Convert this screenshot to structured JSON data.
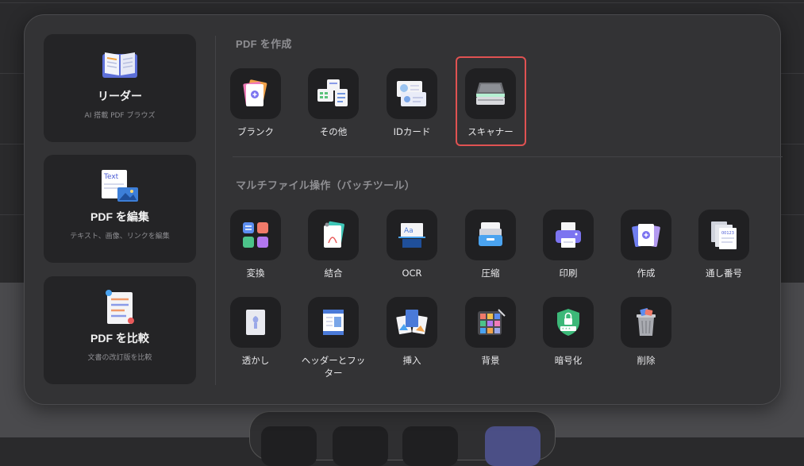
{
  "side_cards": [
    {
      "title": "リーダー",
      "subtitle": "AI 搭載 PDF ブラウズ",
      "icon": "book-icon"
    },
    {
      "title": "PDF を編集",
      "subtitle": "テキスト、画像、リンクを編集",
      "icon": "edit-text-icon",
      "art_text": "Text"
    },
    {
      "title": "PDF を比較",
      "subtitle": "文書の改訂版を比較",
      "icon": "compare-icon"
    }
  ],
  "create_section": {
    "title": "PDF を作成",
    "tools": [
      {
        "label": "ブランク",
        "icon": "blank-pages-icon"
      },
      {
        "label": "その他",
        "icon": "other-files-icon"
      },
      {
        "label": "IDカード",
        "icon": "id-card-icon"
      },
      {
        "label": "スキャナー",
        "icon": "scanner-icon",
        "selected": true
      }
    ]
  },
  "batch_section": {
    "title": "マルチファイル操作（バッチツール）",
    "tools": [
      {
        "label": "変換",
        "icon": "convert-icon"
      },
      {
        "label": "結合",
        "icon": "combine-icon"
      },
      {
        "label": "OCR",
        "icon": "ocr-icon"
      },
      {
        "label": "圧縮",
        "icon": "compress-icon"
      },
      {
        "label": "印刷",
        "icon": "print-icon"
      },
      {
        "label": "作成",
        "icon": "create-icon"
      },
      {
        "label": "通し番号",
        "icon": "bates-number-icon"
      },
      {
        "label": "透かし",
        "icon": "watermark-icon"
      },
      {
        "label": "ヘッダーとフッター",
        "icon": "header-footer-icon"
      },
      {
        "label": "挿入",
        "icon": "insert-icon"
      },
      {
        "label": "背景",
        "icon": "background-icon"
      },
      {
        "label": "暗号化",
        "icon": "encrypt-icon"
      },
      {
        "label": "削除",
        "icon": "delete-icon"
      }
    ]
  },
  "colors": {
    "selection_border": "#e05252",
    "panel": "#333335",
    "tile": "#202022"
  }
}
